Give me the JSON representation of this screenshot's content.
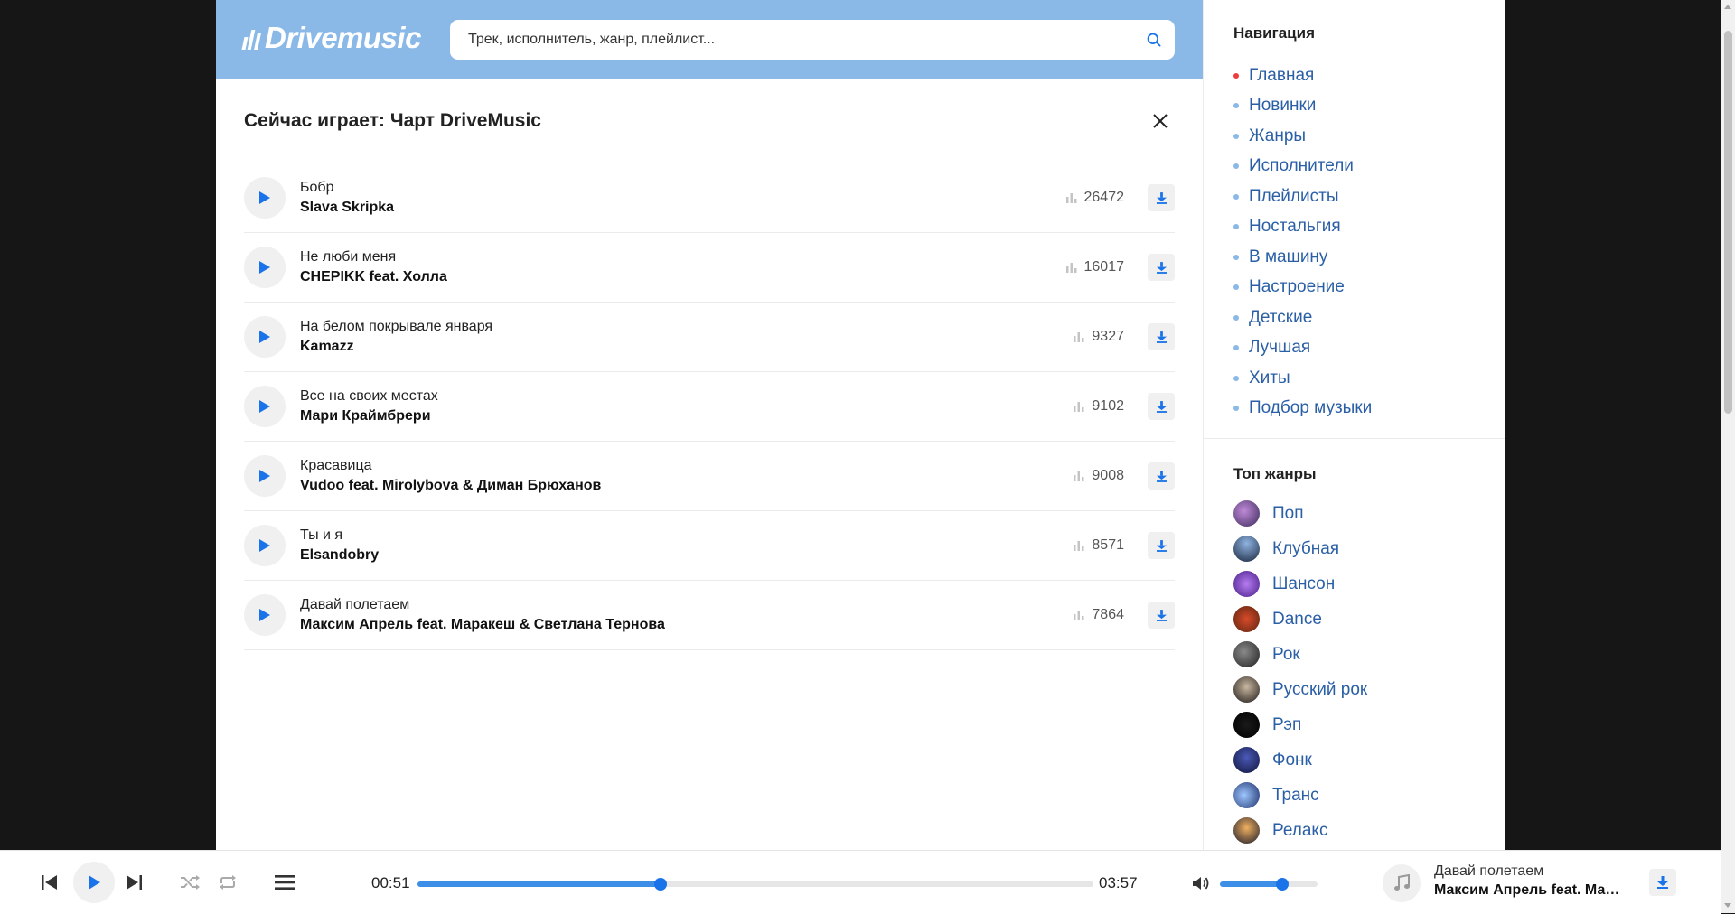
{
  "header": {
    "logo_text": "Drivemusic",
    "search_placeholder": "Трек, исполнитель, жанр, плейлист..."
  },
  "main": {
    "title": "Сейчас играет: Чарт DriveMusic",
    "tracks": [
      {
        "title": "Бобр",
        "artist": "Slava Skripka",
        "plays": "26472"
      },
      {
        "title": "Не люби меня",
        "artist": "CHEPIKK feat. Холла",
        "plays": "16017"
      },
      {
        "title": "На белом покрывале января",
        "artist": "Kamazz",
        "plays": "9327"
      },
      {
        "title": "Все на своих местах",
        "artist": "Мари Краймбрери",
        "plays": "9102"
      },
      {
        "title": "Красавица",
        "artist": "Vudoo feat. Mirolybova & Диман Брюханов",
        "plays": "9008"
      },
      {
        "title": "Ты и я",
        "artist": "Elsandobry",
        "plays": "8571"
      },
      {
        "title": "Давай полетаем",
        "artist": "Максим Апрель feat. Маракеш & Светлана Тернова",
        "plays": "7864"
      }
    ]
  },
  "sidebar": {
    "nav_heading": "Навигация",
    "nav_items": [
      "Главная",
      "Новинки",
      "Жанры",
      "Исполнители",
      "Плейлисты",
      "Ностальгия",
      "В машину",
      "Настроение",
      "Детские",
      "Лучшая",
      "Хиты",
      "Подбор музыки"
    ],
    "genres_heading": "Топ жанры",
    "genres": [
      "Поп",
      "Клубная",
      "Шансон",
      "Dance",
      "Рок",
      "Русский рок",
      "Рэп",
      "Фонк",
      "Транс",
      "Релакс"
    ]
  },
  "player": {
    "current_time": "00:51",
    "duration": "03:57",
    "progress": 0.36,
    "volume": 0.64,
    "now_playing_title": "Давай полетаем",
    "now_playing_artist": "Максим Апрель feat. Мара..."
  },
  "colors": {
    "header_bg": "#8ab9e8",
    "accent": "#1a73e8",
    "link": "#2a5fa6",
    "active_dot": "#ef3b3b"
  }
}
